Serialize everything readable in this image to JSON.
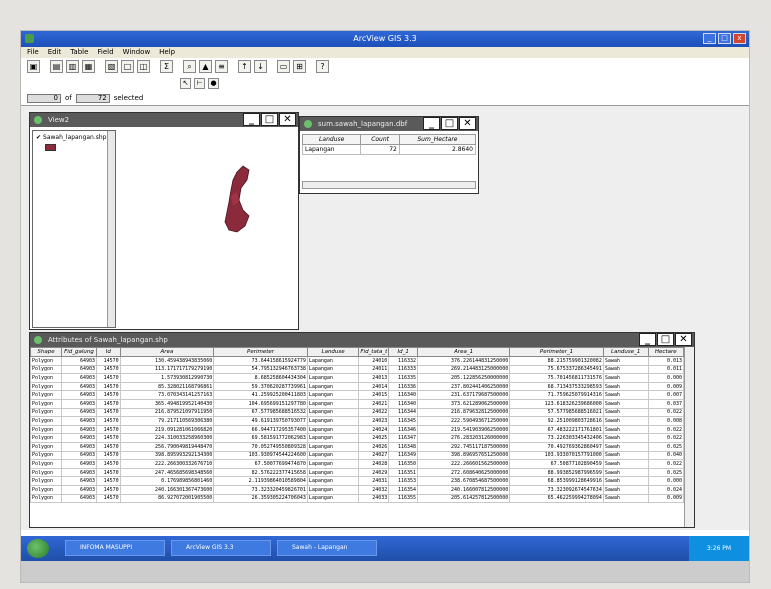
{
  "app": {
    "title": "ArcView GIS 3.3",
    "controls": [
      "_",
      "□",
      "x"
    ]
  },
  "menu": [
    "File",
    "Edit",
    "Table",
    "Field",
    "Window",
    "Help"
  ],
  "selection": {
    "count": "0",
    "of_label": "of",
    "total": "72",
    "selected_label": "selected"
  },
  "view1": {
    "title": "View2",
    "layer_name": "Sawah_lapangan.shp",
    "layer_checked": true,
    "polygon_color": "#8b2a3a"
  },
  "summary": {
    "title": "sum.sawah_lapangan.dbf",
    "columns": [
      "Landuse",
      "Count",
      "Sum_Hectare"
    ],
    "rows": [
      [
        "Lapangan",
        "72",
        "2.8640"
      ]
    ]
  },
  "attr": {
    "title": "Attributes of Sawah_lapangan.shp",
    "columns": [
      "Shape",
      "Fid_galung",
      "Id",
      "Area",
      "Perimeter",
      "Landuse",
      "Fid_tata_t",
      "Id_1",
      "Area_1",
      "Perimeter_1",
      "Landuse_1",
      "Hectare"
    ],
    "rows": [
      [
        "Polygon",
        "64903",
        "14570",
        "130.459438943835060",
        "73.644158615924779",
        "Lapangan",
        "24010",
        "116332",
        "376.226144831250000",
        "88.215759901320082",
        "Sawah",
        "0.013"
      ],
      [
        "Polygon",
        "64903",
        "14570",
        "113.171717179279190",
        "54.795132946763738",
        "Lapangan",
        "24011",
        "116333",
        "269.214483125000000",
        "75.675337286345491",
        "Sawah",
        "0.011"
      ],
      [
        "Polygon",
        "64903",
        "14570",
        "1.573930812990730",
        "8.685258604434304",
        "Lapangan",
        "24013",
        "116335",
        "205.122856250000000",
        "75.701456811731576",
        "Sawah",
        "0.000"
      ],
      [
        "Polygon",
        "64903",
        "14570",
        "85.328021168796861",
        "59.370620287739961",
        "Lapangan",
        "24014",
        "116336",
        "237.802441406250000",
        "68.713437533298593",
        "Sawah",
        "0.009"
      ],
      [
        "Polygon",
        "64903",
        "14570",
        "73.070343141257163",
        "41.259925200411803",
        "Lapangan",
        "24015",
        "116340",
        "231.637179687500000",
        "71.759625079914316",
        "Sawah",
        "0.007"
      ],
      [
        "Polygon",
        "64903",
        "14570",
        "365.494819952140430",
        "104.695699151297780",
        "Lapangan",
        "24021",
        "116340",
        "373.621289062500000",
        "123.618326239686000",
        "Sawah",
        "0.037"
      ],
      [
        "Polygon",
        "64903",
        "14570",
        "216.879521097911950",
        "67.577985688516532",
        "Lapangan",
        "24022",
        "116344",
        "216.879632812500000",
        "57.577985688516021",
        "Sawah",
        "0.022"
      ],
      [
        "Polygon",
        "64903",
        "14570",
        "79.217110569306380",
        "49.619139750793077",
        "Lapangan",
        "24023",
        "116345",
        "222.590493671250000",
        "92.251009803728616",
        "Sawah",
        "0.008"
      ],
      [
        "Polygon",
        "64903",
        "14570",
        "219.091281061066820",
        "66.944717295357400",
        "Lapangan",
        "24024",
        "116346",
        "219.541903906250000",
        "67.483222171761801",
        "Sawah",
        "0.022"
      ],
      [
        "Polygon",
        "64903",
        "14570",
        "224.310033258960300",
        "69.581591772062983",
        "Lapangan",
        "24025",
        "116347",
        "276.283203126000000",
        "73.226303345432406",
        "Sawah",
        "0.022"
      ],
      [
        "Polygon",
        "64903",
        "14570",
        "256.790049819448470",
        "70.052749550809328",
        "Lapangan",
        "24026",
        "116348",
        "292.745117187500000",
        "70.492769362860497",
        "Sawah",
        "0.025"
      ],
      [
        "Polygon",
        "64903",
        "14570",
        "398.895993292134300",
        "103.930974544224600",
        "Lapangan",
        "24027",
        "116349",
        "398.896957651250000",
        "103.933070157791000",
        "Sawah",
        "0.040"
      ],
      [
        "Polygon",
        "64903",
        "14570",
        "222.266300332676710",
        "67.50077699474870",
        "Lapangan",
        "24028",
        "116350",
        "222.266601562500000",
        "67.50877102890459",
        "Sawah",
        "0.022"
      ],
      [
        "Polygon",
        "64903",
        "14570",
        "247.465685698348560",
        "82.576222377415658",
        "Lapangan",
        "24029",
        "116351",
        "272.608640625000000",
        "88.993852987996599",
        "Sawah",
        "0.025"
      ],
      [
        "Polygon",
        "64903",
        "14570",
        "0.176989856801460",
        "2.11939864010589804",
        "Lapangan",
        "24031",
        "116353",
        "238.670854687500000",
        "68.853999128649916",
        "Sawah",
        "0.000"
      ],
      [
        "Polygon",
        "64903",
        "14570",
        "240.166301367473600",
        "73.323320459826701",
        "Lapangan",
        "24032",
        "116354",
        "240.166007812500000",
        "73.323092674547634",
        "Sawah",
        "0.024"
      ],
      [
        "Polygon",
        "64903",
        "14570",
        "86.927072001905500",
        "26.359305224706043",
        "Lapangan",
        "24033",
        "116355",
        "205.614257812500000",
        "65.462259994278094",
        "Sawah",
        "0.009"
      ]
    ]
  },
  "taskbar": {
    "tasks": [
      "INFOMA MASUPPI",
      "ArcView GIS 3.3",
      "Sawah - Lapangan"
    ],
    "clock": "3:26 PM"
  }
}
